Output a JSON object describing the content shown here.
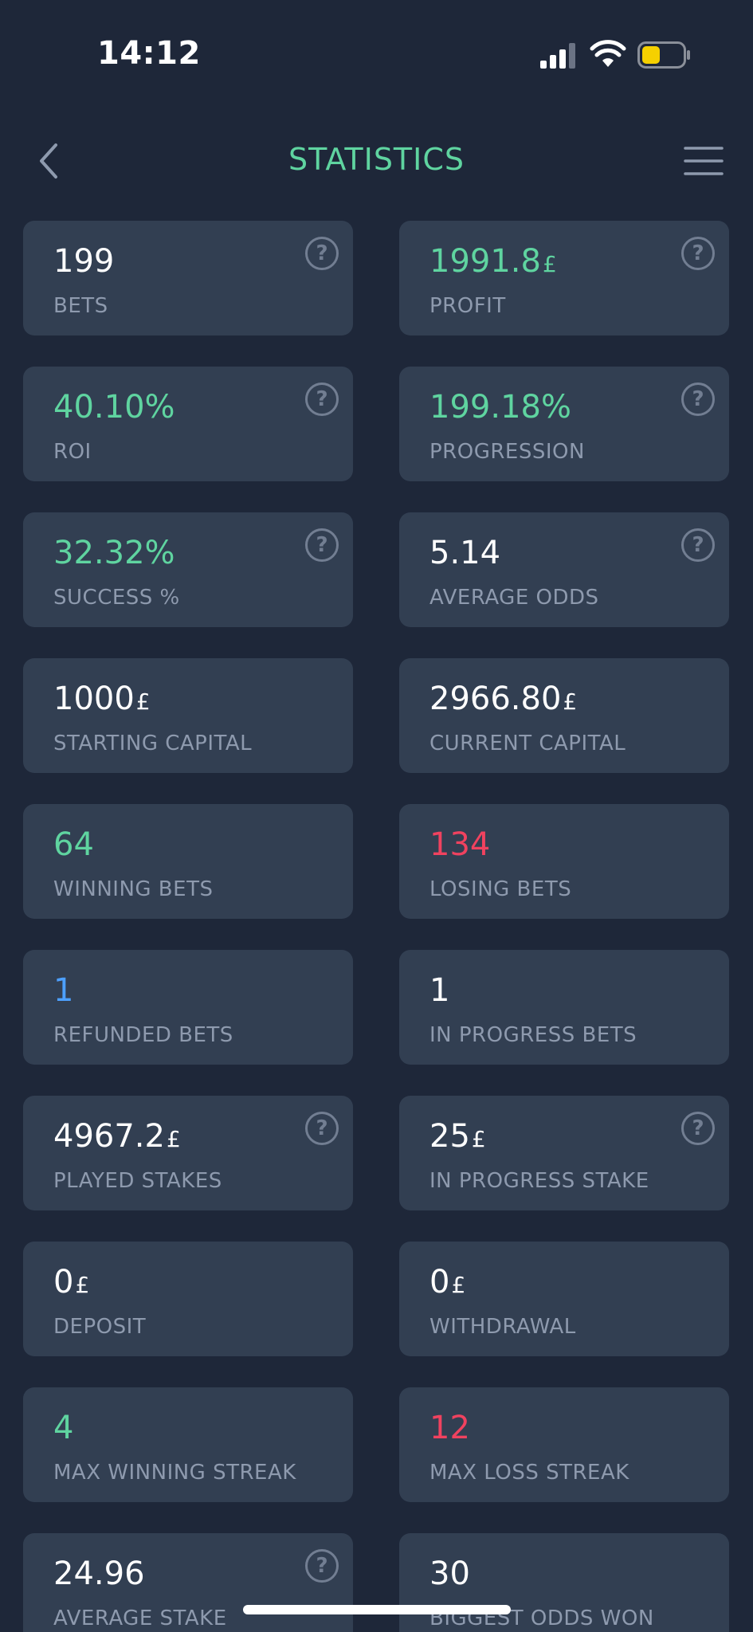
{
  "status_bar": {
    "time": "14:12",
    "icons": [
      "cellular-signal-icon",
      "wifi-icon",
      "battery-icon"
    ],
    "battery_color": "#f5d000"
  },
  "header": {
    "title": "STATISTICS",
    "back_icon": "chevron-left-icon",
    "menu_icon": "hamburger-menu-icon"
  },
  "colors": {
    "background": "#1e2739",
    "card": "#323f52",
    "positive": "#5fd4a0",
    "negative": "#f0425f",
    "neutral": "#4da0ff",
    "label": "#8e9aae"
  },
  "help_glyph": "?",
  "currency_symbol": "£",
  "stats": [
    {
      "value": "199",
      "label": "BETS",
      "color": "white",
      "help": true
    },
    {
      "value": "1991.8",
      "currency": true,
      "label": "PROFIT",
      "color": "green",
      "help": true
    },
    {
      "value": "40.10%",
      "label": "ROI",
      "color": "green",
      "help": true
    },
    {
      "value": "199.18%",
      "label": "PROGRESSION",
      "color": "green",
      "help": true
    },
    {
      "value": "32.32%",
      "label": "SUCCESS %",
      "color": "green",
      "help": true
    },
    {
      "value": "5.14",
      "label": "AVERAGE ODDS",
      "color": "white",
      "help": true
    },
    {
      "value": "1000",
      "currency": true,
      "label": "STARTING CAPITAL",
      "color": "white",
      "help": false
    },
    {
      "value": "2966.80",
      "currency": true,
      "label": "CURRENT CAPITAL",
      "color": "white",
      "help": false
    },
    {
      "value": "64",
      "label": "WINNING BETS",
      "color": "green",
      "help": false
    },
    {
      "value": "134",
      "label": "LOSING BETS",
      "color": "red",
      "help": false
    },
    {
      "value": "1",
      "label": "REFUNDED BETS",
      "color": "blue",
      "help": false
    },
    {
      "value": "1",
      "label": "IN PROGRESS BETS",
      "color": "white",
      "help": false
    },
    {
      "value": "4967.2",
      "currency": true,
      "label": "PLAYED STAKES",
      "color": "white",
      "help": true
    },
    {
      "value": "25",
      "currency": true,
      "label": "IN PROGRESS STAKE",
      "color": "white",
      "help": true
    },
    {
      "value": "0",
      "currency": true,
      "label": "DEPOSIT",
      "color": "white",
      "help": false
    },
    {
      "value": "0",
      "currency": true,
      "label": "WITHDRAWAL",
      "color": "white",
      "help": false
    },
    {
      "value": "4",
      "label": "MAX WINNING STREAK",
      "color": "green",
      "help": false
    },
    {
      "value": "12",
      "label": "MAX LOSS STREAK",
      "color": "red",
      "help": false
    },
    {
      "value": "24.96",
      "label": "AVERAGE STAKE",
      "color": "white",
      "help": true
    },
    {
      "value": "30",
      "label": "BIGGEST ODDS WON",
      "color": "white",
      "help": false
    }
  ]
}
